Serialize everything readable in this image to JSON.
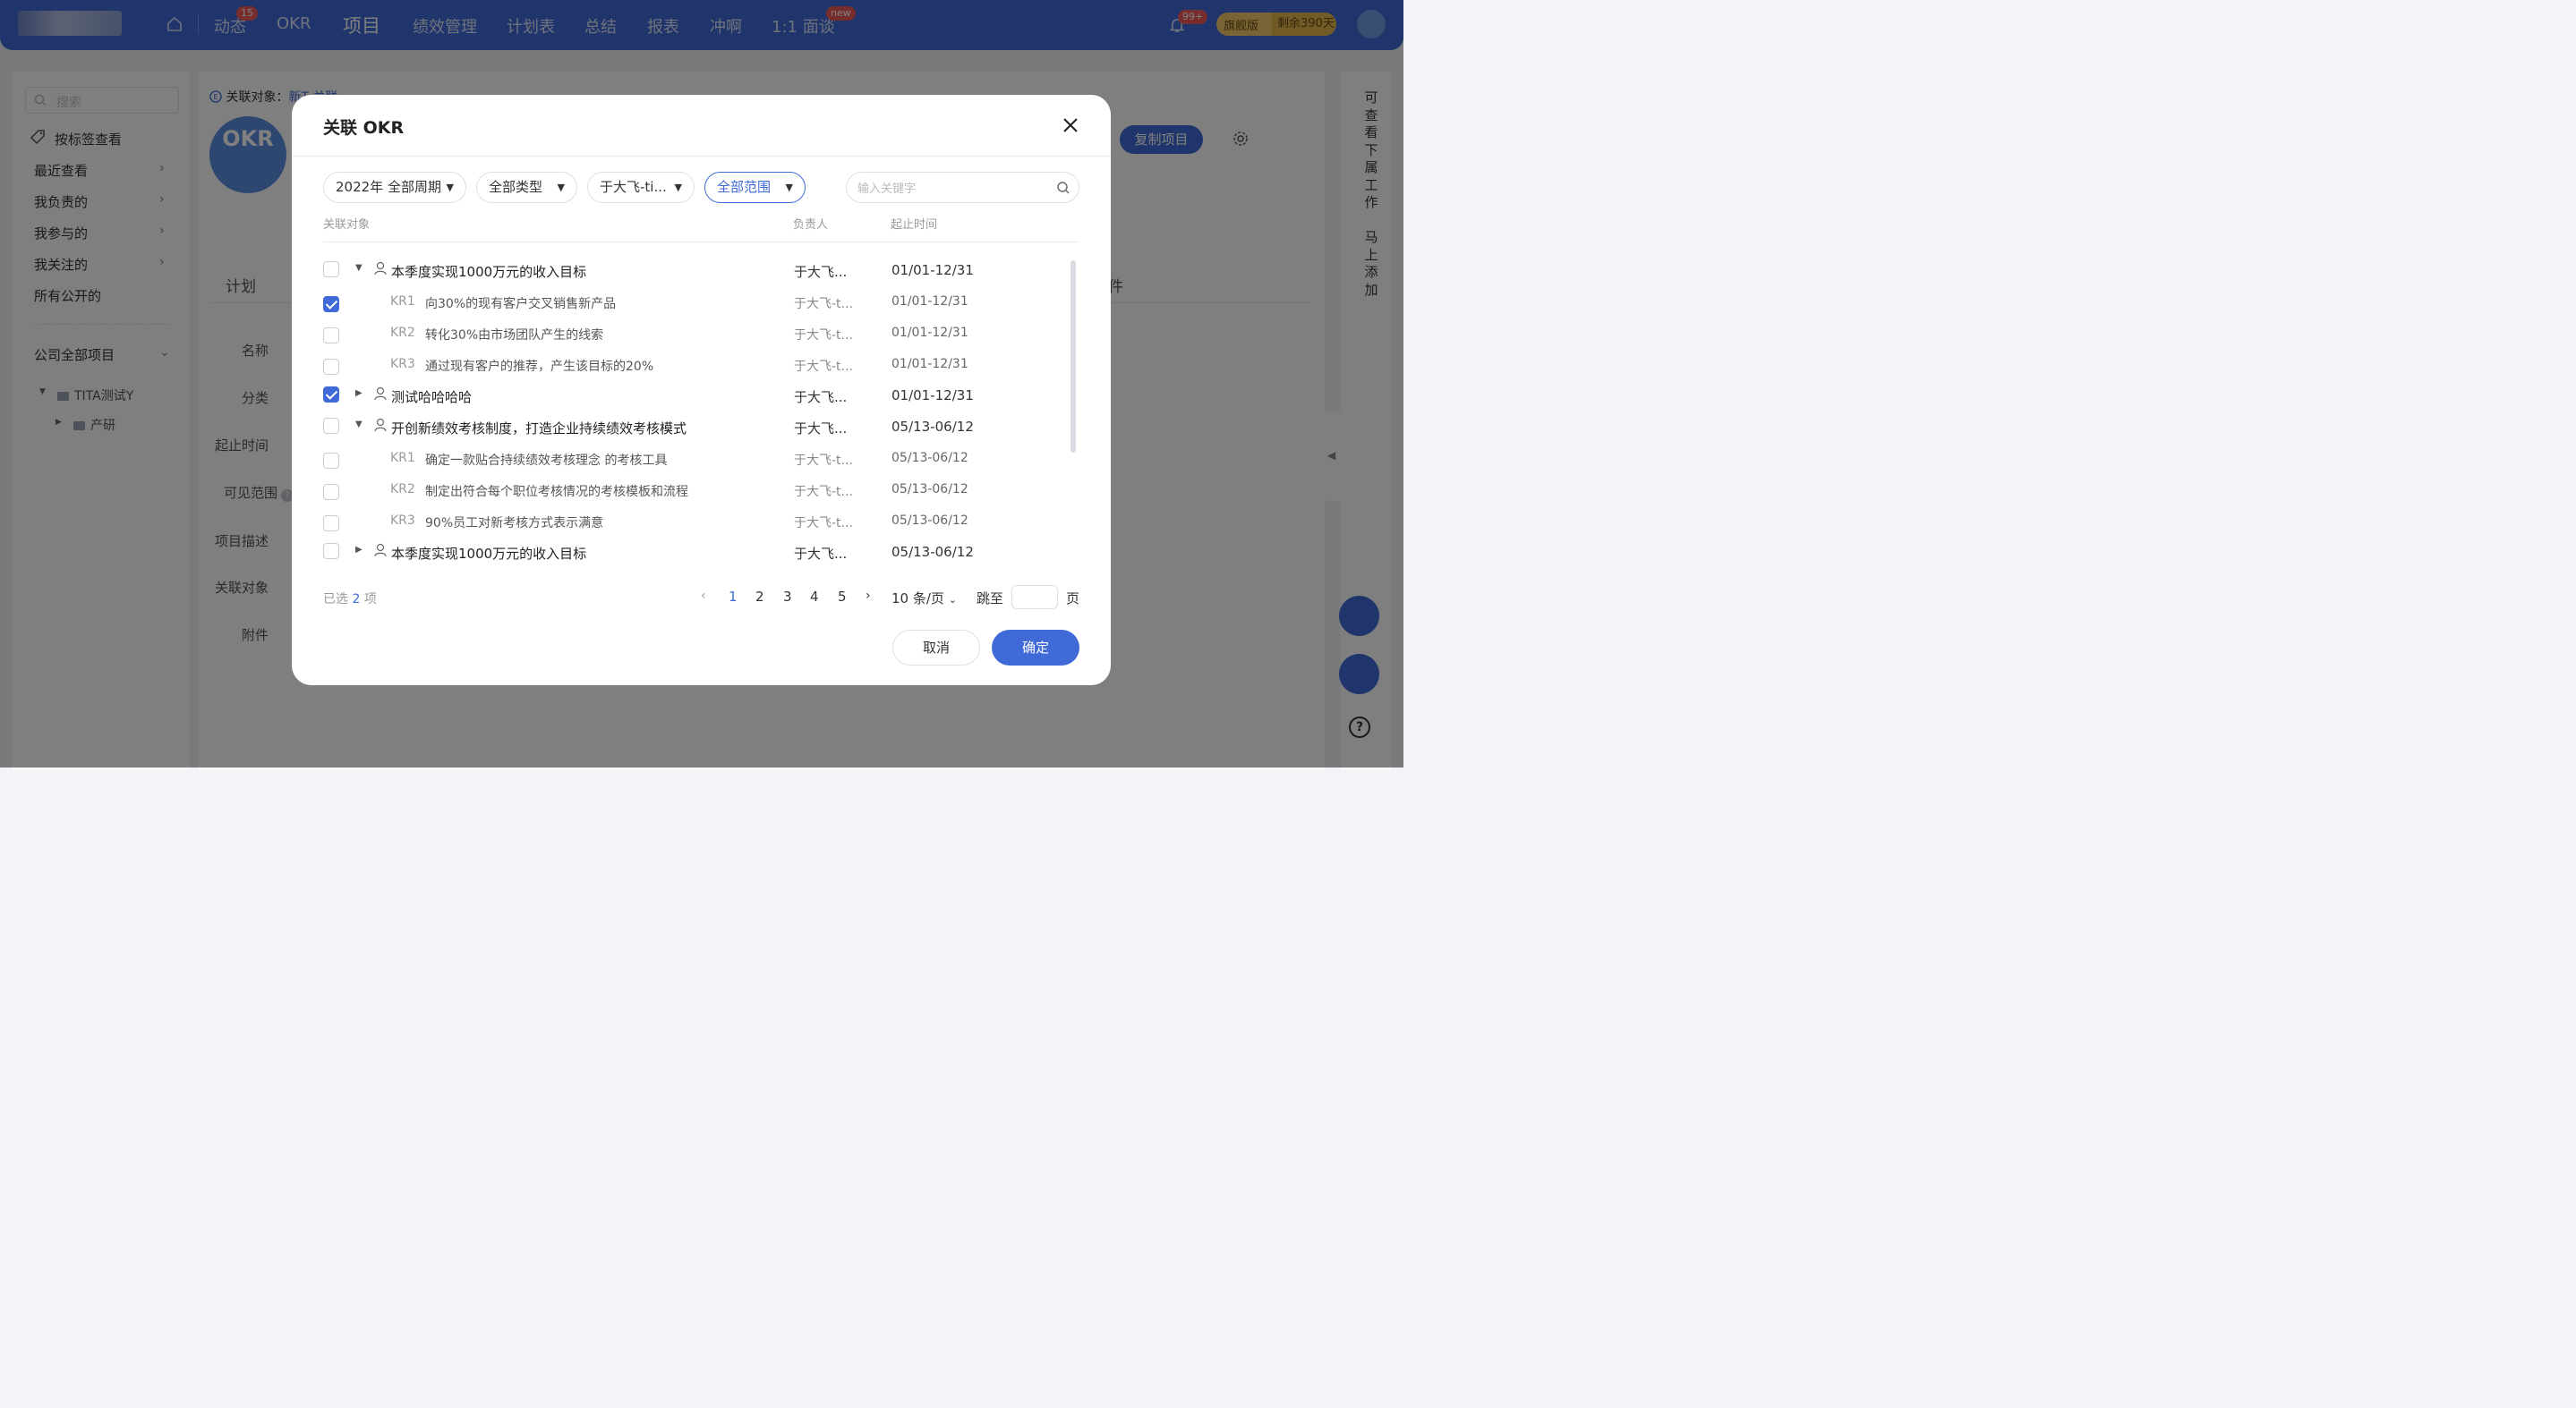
{
  "topnav": {
    "items": [
      "动态",
      "OKR",
      "项目",
      "绩效管理",
      "计划表",
      "总结",
      "报表",
      "冲啊",
      "1:1 面谈"
    ],
    "dynamic_badge": "15",
    "interview_badge": "new",
    "bell_badge": "99+",
    "edition_label": "旗舰版",
    "edition_remaining": "剩余390天"
  },
  "sidebar": {
    "search_placeholder": "搜索",
    "by_tag": "按标签查看",
    "items": [
      "最近查看",
      "我负责的",
      "我参与的",
      "我关注的",
      "所有公开的"
    ],
    "company_projects": "公司全部项目",
    "tree": [
      "TITA测试Y",
      "产研"
    ]
  },
  "main": {
    "rel_label": "关联对象：",
    "rel_link": "新T 关联",
    "logo_text": "OKR",
    "copy_button": "复制项目",
    "tab_plan": "计划",
    "tab_files": "件",
    "fields": [
      "名称",
      "分类",
      "起止时间",
      "可见范围",
      "项目描述",
      "关联对象",
      "附件"
    ]
  },
  "right_strip": {
    "view_subordinates": "可查看下属工作",
    "add_now": "马上添加"
  },
  "modal": {
    "title": "关联 OKR",
    "filters": {
      "period": "2022年 全部周期",
      "type": "全部类型",
      "owner": "于大飞-ti...",
      "scope": "全部范围"
    },
    "keyword_placeholder": "输入关键字",
    "headers": {
      "object": "关联对象",
      "owner": "负责人",
      "time": "起止时间"
    },
    "rows": [
      {
        "kind": "objective",
        "checked": false,
        "expanded": true,
        "title": "本季度实现1000万元的收入目标",
        "owner": "于大飞...",
        "date": "01/01-12/31"
      },
      {
        "kind": "kr",
        "checked": true,
        "tag": "KR1",
        "title": "向30%的现有客户交叉销售新产品",
        "owner": "于大飞-t...",
        "date": "01/01-12/31"
      },
      {
        "kind": "kr",
        "checked": false,
        "tag": "KR2",
        "title": "转化30%由市场团队产生的线索",
        "owner": "于大飞-t...",
        "date": "01/01-12/31"
      },
      {
        "kind": "kr",
        "checked": false,
        "tag": "KR3",
        "title": "通过现有客户的推荐，产生该目标的20%",
        "owner": "于大飞-t...",
        "date": "01/01-12/31"
      },
      {
        "kind": "objective",
        "checked": true,
        "expanded": false,
        "title": "测试哈哈哈哈",
        "owner": "于大飞...",
        "date": "01/01-12/31"
      },
      {
        "kind": "objective",
        "checked": false,
        "expanded": true,
        "title": "开创新绩效考核制度，打造企业持续绩效考核模式",
        "owner": "于大飞...",
        "date": "05/13-06/12"
      },
      {
        "kind": "kr",
        "checked": false,
        "tag": "KR1",
        "title": "确定一款贴合持续绩效考核理念 的考核工具",
        "owner": "于大飞-t...",
        "date": "05/13-06/12"
      },
      {
        "kind": "kr",
        "checked": false,
        "tag": "KR2",
        "title": "制定出符合每个职位考核情况的考核模板和流程",
        "owner": "于大飞-t...",
        "date": "05/13-06/12"
      },
      {
        "kind": "kr",
        "checked": false,
        "tag": "KR3",
        "title": "90%员工对新考核方式表示满意",
        "owner": "于大飞-t...",
        "date": "05/13-06/12"
      },
      {
        "kind": "objective",
        "checked": false,
        "expanded": false,
        "title": "本季度实现1000万元的收入目标",
        "owner": "于大飞...",
        "date": "05/13-06/12"
      }
    ],
    "selected_prefix": "已选",
    "selected_count": "2",
    "selected_suffix": "项",
    "pages": [
      "1",
      "2",
      "3",
      "4",
      "5"
    ],
    "current_page": "1",
    "page_size": "10 条/页",
    "jump_label": "跳至",
    "page_label": "页",
    "cancel": "取消",
    "ok": "确定"
  },
  "colors": {
    "brand": "#3f6ad8",
    "badge": "#f05b5b",
    "edition": "#f0c86a"
  }
}
